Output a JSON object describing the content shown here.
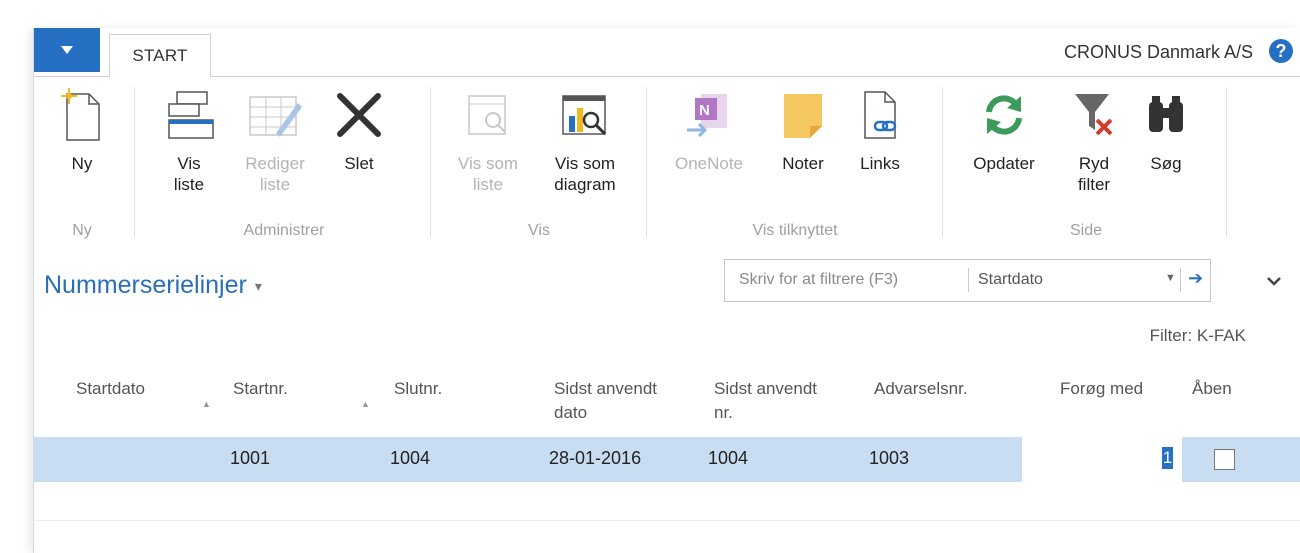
{
  "app": {
    "tab_start": "START",
    "company": "CRONUS Danmark A/S",
    "help": "?"
  },
  "ribbon": {
    "groups": [
      {
        "label": "Ny"
      },
      {
        "label": "Administrer"
      },
      {
        "label": "Vis"
      },
      {
        "label": "Vis tilknyttet"
      },
      {
        "label": "Side"
      }
    ],
    "buttons": {
      "ny": [
        "Ny"
      ],
      "vis_liste": [
        "Vis",
        "liste"
      ],
      "rediger_liste": [
        "Rediger",
        "liste"
      ],
      "slet": [
        "Slet"
      ],
      "vis_som_liste": [
        "Vis som",
        "liste"
      ],
      "vis_som_diagram": [
        "Vis som",
        "diagram"
      ],
      "onenote": [
        "OneNote"
      ],
      "noter": [
        "Noter"
      ],
      "links": [
        "Links"
      ],
      "opdater": [
        "Opdater"
      ],
      "ryd_filter": [
        "Ryd",
        "filter"
      ],
      "sog": [
        "Søg"
      ]
    }
  },
  "page": {
    "title": "Nummerserielinjer",
    "filter_placeholder": "Skriv for at filtrere (F3)",
    "filter_field": "Startdato",
    "filter_text": "Filter: K-FAK"
  },
  "table": {
    "headers": [
      [
        "Startdato"
      ],
      [
        "Startnr."
      ],
      [
        "Slutnr."
      ],
      [
        "Sidst anvendt",
        "dato"
      ],
      [
        "Sidst anvendt",
        "nr."
      ],
      [
        "Advarselsnr."
      ],
      [
        "Forøg med"
      ],
      [
        "Åben"
      ]
    ],
    "rows": [
      {
        "startdato": "",
        "startnr": "1001",
        "slutnr": "1004",
        "sidst_dato": "28-01-2016",
        "sidst_nr": "1004",
        "advarselsnr": "1003",
        "forog_med": "1",
        "aaben": false
      }
    ]
  },
  "colors": {
    "accent": "#2670c4",
    "selected_row": "#c8ddf1",
    "title": "#2a70b8"
  }
}
